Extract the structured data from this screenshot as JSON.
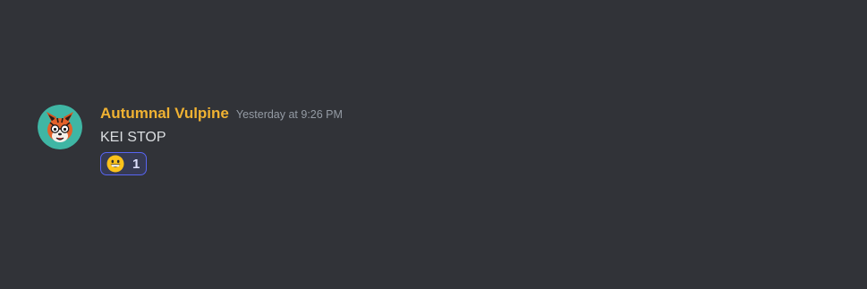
{
  "message": {
    "username": "Autumnal Vulpine",
    "timestamp": "Yesterday at 9:26 PM",
    "text": "KEI STOP",
    "avatar_icon": "fox-avatar",
    "username_color": "#f0b232",
    "reactions": [
      {
        "emoji": "grinning-face-icon",
        "count": "1",
        "active": true
      }
    ]
  },
  "colors": {
    "background": "#313338",
    "reaction_border": "#5865f2",
    "text": "#dbdee1",
    "timestamp": "#949ba4"
  }
}
